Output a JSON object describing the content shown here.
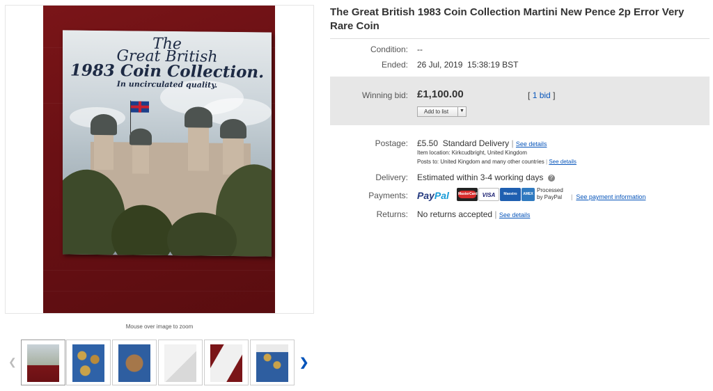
{
  "item": {
    "title": "The Great British 1983 Coin Collection Martini New Pence 2p Error Very Rare Coin"
  },
  "gallery": {
    "booklet_lines": [
      "The",
      "Great British",
      "1983 Coin Collection.",
      "In uncirculated quality."
    ],
    "zoom_hint": "Mouse over image to zoom",
    "prev_icon": "chevron-left-icon",
    "next_icon": "chevron-right-icon",
    "thumbnails": [
      {
        "label": "thumbnail-1"
      },
      {
        "label": "thumbnail-2"
      },
      {
        "label": "thumbnail-3"
      },
      {
        "label": "thumbnail-4"
      },
      {
        "label": "thumbnail-5"
      },
      {
        "label": "thumbnail-6"
      }
    ]
  },
  "details": {
    "condition_label": "Condition:",
    "condition_value": "--",
    "ended_label": "Ended:",
    "ended_value": "26 Jul, 2019  15:38:19 BST"
  },
  "bid": {
    "winning_label": "Winning bid:",
    "winning_amount": "£1,100.00",
    "bid_open": "[",
    "bid_count": "1 bid",
    "bid_close": "]",
    "add_to_list": "Add to list"
  },
  "postage": {
    "label": "Postage:",
    "price": "£5.50",
    "method": "Standard Delivery",
    "see_details": "See details",
    "item_location": "Item location:  Kirkcudbright, United Kingdom",
    "posts_to": "Posts to:  United Kingdom and many other countries",
    "posts_to_details": "See details"
  },
  "delivery": {
    "label": "Delivery:",
    "value": "Estimated within 3-4 working days",
    "help_icon": "question-icon"
  },
  "payments": {
    "label": "Payments:",
    "paypal_pay": "Pay",
    "paypal_pal": "Pal",
    "cards": [
      {
        "name": "mastercard-icon",
        "text": "MasterCard",
        "color": "#d62d2d"
      },
      {
        "name": "visa-icon",
        "text": "VISA",
        "color": "#ffffff"
      },
      {
        "name": "maestro-icon",
        "text": "Maestro",
        "color": "#1f5fb0"
      },
      {
        "name": "amex-icon",
        "text": "AMEX",
        "color": "#2f7ac0"
      }
    ],
    "processed_line1": "Processed",
    "processed_line2": "by PayPal",
    "see_payment": "See payment information"
  },
  "returns": {
    "label": "Returns:",
    "value": "No returns accepted",
    "see_details": "See details"
  },
  "colors": {
    "link": "#0654ba",
    "panel": "#e7e7e7",
    "paypal_dark": "#253b80",
    "paypal_light": "#179bd7"
  }
}
